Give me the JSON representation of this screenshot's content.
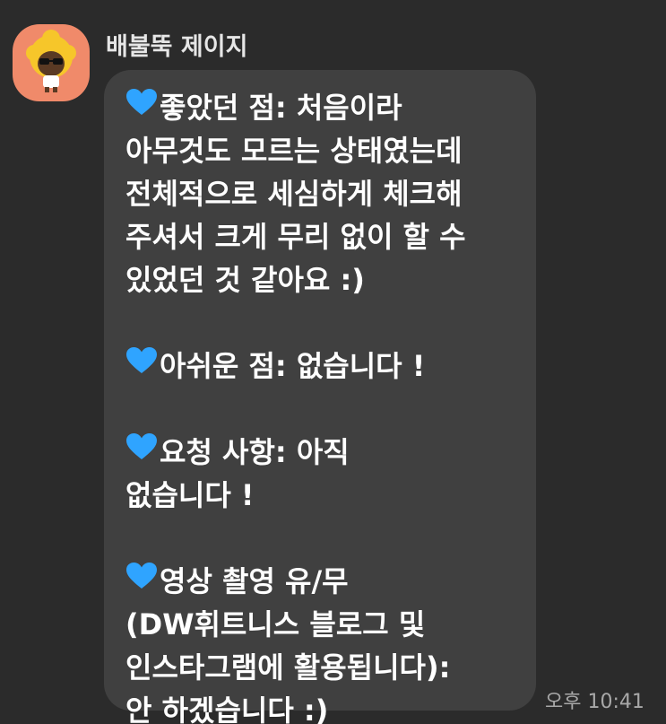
{
  "chat": {
    "sender_name": "배불뚝 제이지",
    "timestamp": "오후 10:41",
    "heart_color": "#2fa4ff",
    "avatar_bg_color": "#f08a6a",
    "message": {
      "line1": "좋았던 점: 처음이라",
      "line2": "아무것도 모르는 상태였는데",
      "line3": "전체적으로 세심하게 체크해",
      "line4": "주셔서 크게 무리 없이 할 수",
      "line5": "있었던 것 같아요 :)",
      "line6": "아쉬운 점: 없습니다 !",
      "line7": "요청 사항: 아직",
      "line8": "없습니다 !",
      "line9": "영상 촬영 유/무",
      "line10": "(DW휘트니스 블로그 및",
      "line11": "인스타그램에 활용됩니다):",
      "line12": "안 하겠습니다 :)"
    }
  }
}
